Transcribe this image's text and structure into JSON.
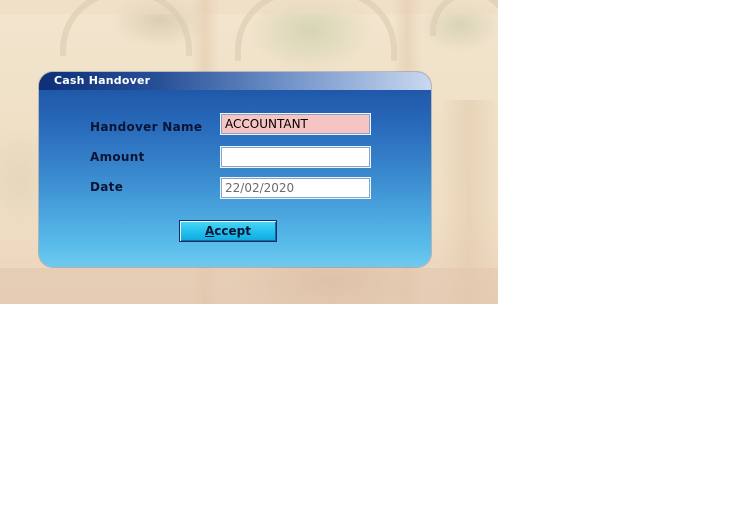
{
  "dialog": {
    "title": "Cash Handover",
    "fields": {
      "handover_name": {
        "label": "Handover Name",
        "value": "ACCOUNTANT"
      },
      "amount": {
        "label": "Amount",
        "value": ""
      },
      "date": {
        "label": "Date",
        "value": "22/02/2020"
      }
    },
    "accept_button": {
      "mnemonic": "A",
      "rest": "ccept"
    }
  },
  "colors": {
    "dialog_top": "#1b4fa0",
    "dialog_bottom": "#6fc9ee",
    "name_field_bg": "#f7c4c4",
    "button": "#20bfee"
  }
}
